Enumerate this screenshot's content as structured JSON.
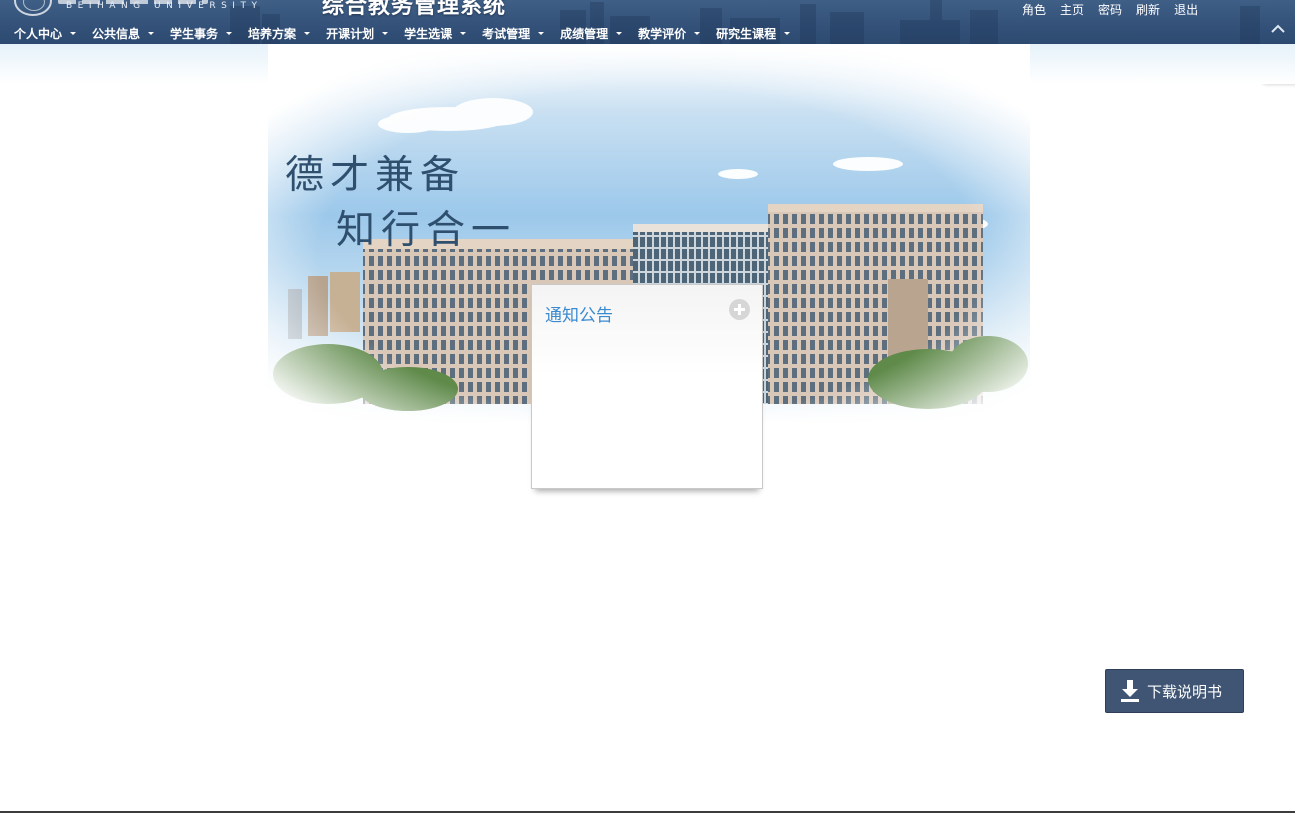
{
  "header": {
    "logo_en": "BEIHANG UNIVERSITY",
    "system_title": "综合教务管理系统",
    "top_links": [
      {
        "label": "角色"
      },
      {
        "label": "主页"
      },
      {
        "label": "密码"
      },
      {
        "label": "刷新"
      },
      {
        "label": "退出"
      }
    ],
    "nav": [
      {
        "label": "个人中心"
      },
      {
        "label": "公共信息"
      },
      {
        "label": "学生事务"
      },
      {
        "label": "培养方案"
      },
      {
        "label": "开课计划"
      },
      {
        "label": "学生选课"
      },
      {
        "label": "考试管理"
      },
      {
        "label": "成绩管理"
      },
      {
        "label": "教学评价"
      },
      {
        "label": "研究生课程"
      }
    ]
  },
  "banner": {
    "slogan_line1": "德才兼备",
    "slogan_line2": "知行合一"
  },
  "notice": {
    "title": "通知公告"
  },
  "download": {
    "label": "下载说明书"
  },
  "colors": {
    "header_bg": "#34527a",
    "notice_title": "#3a8ad0",
    "download_bg": "#3f5573"
  }
}
